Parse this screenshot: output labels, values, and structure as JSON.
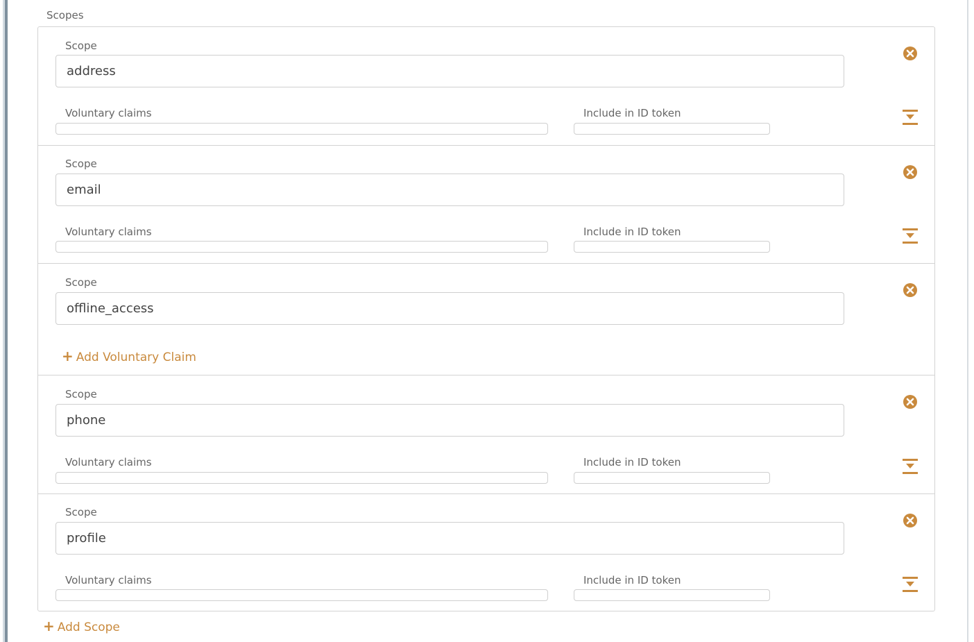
{
  "colors": {
    "accent": "#c98a3d",
    "border": "#d3d3d3"
  },
  "scopes_section": {
    "label": "Scopes",
    "rows": [
      {
        "scope_label": "Scope",
        "scope_value": "address",
        "voluntary_claims_label": "Voluntary claims",
        "include_id_token_label": "Include in ID token",
        "remove_icon": "close-circle-icon",
        "collapse_icon": "collapse-icon"
      },
      {
        "scope_label": "Scope",
        "scope_value": "email",
        "voluntary_claims_label": "Voluntary claims",
        "include_id_token_label": "Include in ID token",
        "remove_icon": "close-circle-icon",
        "collapse_icon": "collapse-icon"
      },
      {
        "scope_label": "Scope",
        "scope_value": "offline_access",
        "add_claim_label": "Add Voluntary Claim",
        "remove_icon": "close-circle-icon"
      },
      {
        "scope_label": "Scope",
        "scope_value": "phone",
        "voluntary_claims_label": "Voluntary claims",
        "include_id_token_label": "Include in ID token",
        "remove_icon": "close-circle-icon",
        "collapse_icon": "collapse-icon"
      },
      {
        "scope_label": "Scope",
        "scope_value": "profile",
        "voluntary_claims_label": "Voluntary claims",
        "include_id_token_label": "Include in ID token",
        "remove_icon": "close-circle-icon",
        "collapse_icon": "collapse-icon"
      }
    ],
    "add_scope_label": "Add Scope"
  }
}
